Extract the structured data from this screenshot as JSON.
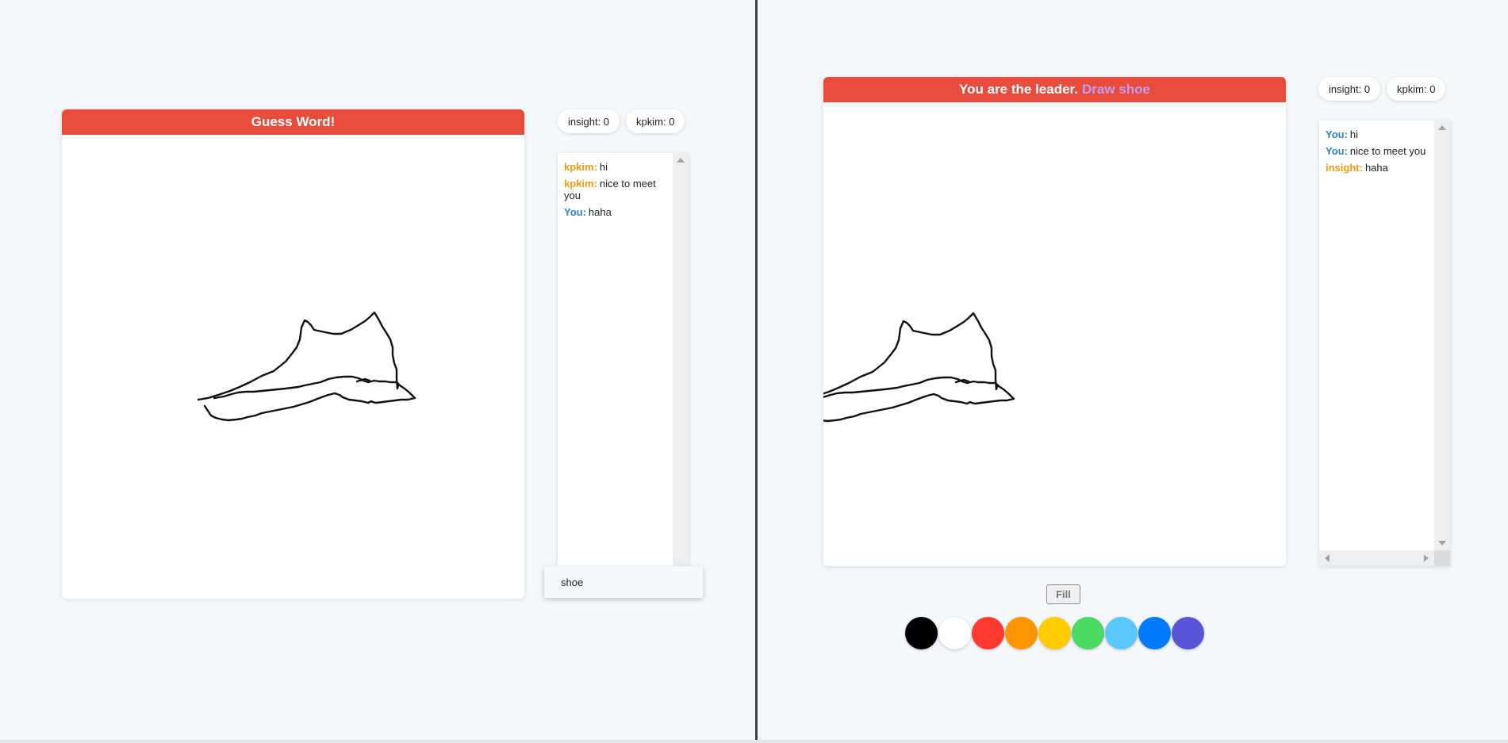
{
  "guesser": {
    "header": "Guess Word!",
    "scores": [
      "insight: 0",
      "kpkim: 0"
    ],
    "chat": [
      {
        "name": "kpkim:",
        "text": "hi",
        "color": "#f39c12"
      },
      {
        "name": "kpkim:",
        "text": "nice to meet you",
        "color": "#f39c12"
      },
      {
        "name": "You:",
        "text": "haha",
        "color": "#2f80c8"
      }
    ],
    "guess_value": "shoe",
    "guess_placeholder": ""
  },
  "leader": {
    "header_prefix": "You are the leader.",
    "header_accent": "Draw shoe",
    "scores": [
      "insight: 0",
      "kpkim: 0"
    ],
    "chat": [
      {
        "name": "You:",
        "text": "hi",
        "color": "#2f80c8"
      },
      {
        "name": "You:",
        "text": "nice to meet you",
        "color": "#2f80c8"
      },
      {
        "name": "insight:",
        "text": "haha",
        "color": "#f39c12"
      }
    ],
    "fill_label": "Fill",
    "palette": [
      {
        "name": "black",
        "color": "#000000"
      },
      {
        "name": "white",
        "color": "#ffffff"
      },
      {
        "name": "red",
        "color": "#ff3b30"
      },
      {
        "name": "orange",
        "color": "#ff9500"
      },
      {
        "name": "yellow",
        "color": "#ffcc00"
      },
      {
        "name": "green",
        "color": "#4cd964"
      },
      {
        "name": "light-blue",
        "color": "#5ac8fa"
      },
      {
        "name": "blue",
        "color": "#007aff"
      },
      {
        "name": "purple",
        "color": "#5856d6"
      }
    ]
  },
  "colors": {
    "header_bg": "#e74c3c",
    "header_accent_text": "#c59cf2",
    "page_bg": "#f4f7fc"
  }
}
